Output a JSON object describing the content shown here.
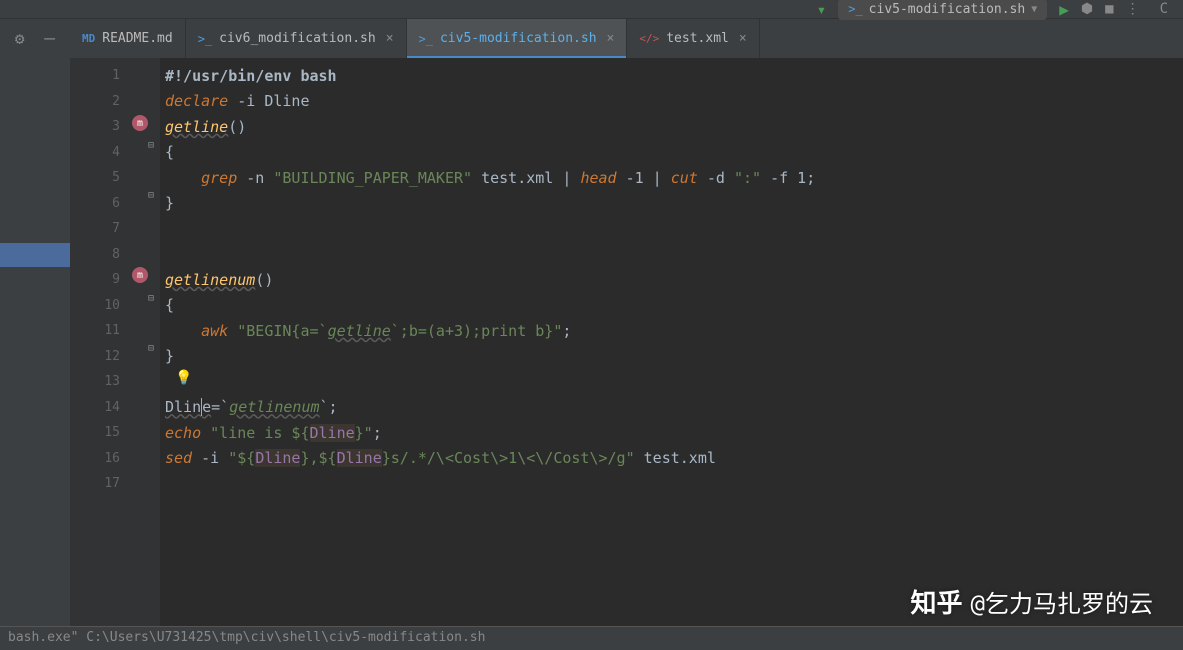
{
  "toolbar": {
    "run_config": "civ5-modification.sh"
  },
  "tabs": [
    {
      "icon": "md",
      "label": "README.md",
      "active": false,
      "closable": false
    },
    {
      "icon": "sh",
      "label": "civ6_modification.sh",
      "active": false,
      "closable": true
    },
    {
      "icon": "sh",
      "label": "civ5-modification.sh",
      "active": true,
      "closable": true
    },
    {
      "icon": "xml",
      "label": "test.xml",
      "active": false,
      "closable": true
    }
  ],
  "code": {
    "lines": [
      "1",
      "2",
      "3",
      "4",
      "5",
      "6",
      "7",
      "8",
      "9",
      "10",
      "11",
      "12",
      "13",
      "14",
      "15",
      "16",
      "17"
    ],
    "l1_shebang": "#!/usr/bin/env bash",
    "l2_kw": "declare",
    "l2_rest": " -i Dline",
    "l3_fn": "getline",
    "l3_paren": "()",
    "l4_brace": "{",
    "l5_indent": "    ",
    "l5_cmd1": "grep",
    "l5_mid1": " -n ",
    "l5_str1": "\"BUILDING_PAPER_MAKER\"",
    "l5_mid2": " test.xml | ",
    "l5_cmd2": "head",
    "l5_mid3": " -1 | ",
    "l5_cmd3": "cut",
    "l5_mid4": " -d ",
    "l5_str2": "\":\"",
    "l5_end": " -f 1;",
    "l6_brace": "}",
    "l9_fn": "getlinenum",
    "l9_paren": "()",
    "l10_brace": "{",
    "l11_indent": "    ",
    "l11_cmd": "awk",
    "l11_sp": " ",
    "l11_str_a": "\"BEGIN{a=`",
    "l11_fn": "getline",
    "l11_str_b": "`;b=(a+3);print b}\"",
    "l11_end": ";",
    "l12_brace": "}",
    "l14_var": "Dline",
    "l14_eq": "=`",
    "l14_fn": "getlinenum",
    "l14_end": "`;",
    "l15_cmd": "echo",
    "l15_sp": " ",
    "l15_str_a": "\"line is ${",
    "l15_var": "Dline",
    "l15_str_b": "}\"",
    "l15_end": ";",
    "l16_cmd": "sed",
    "l16_sp": " -i ",
    "l16_str_a": "\"${",
    "l16_var1": "Dline",
    "l16_str_b": "},${",
    "l16_var2": "Dline",
    "l16_str_c": "}s/.*/\\<Cost\\>1\\<\\/Cost\\>/g\"",
    "l16_end": " test.xml"
  },
  "status": "bash.exe\" C:\\Users\\U731425\\tmp\\civ\\shell\\civ5-modification.sh",
  "watermark": {
    "logo": "知乎",
    "text": "@乞力马扎罗的云"
  }
}
